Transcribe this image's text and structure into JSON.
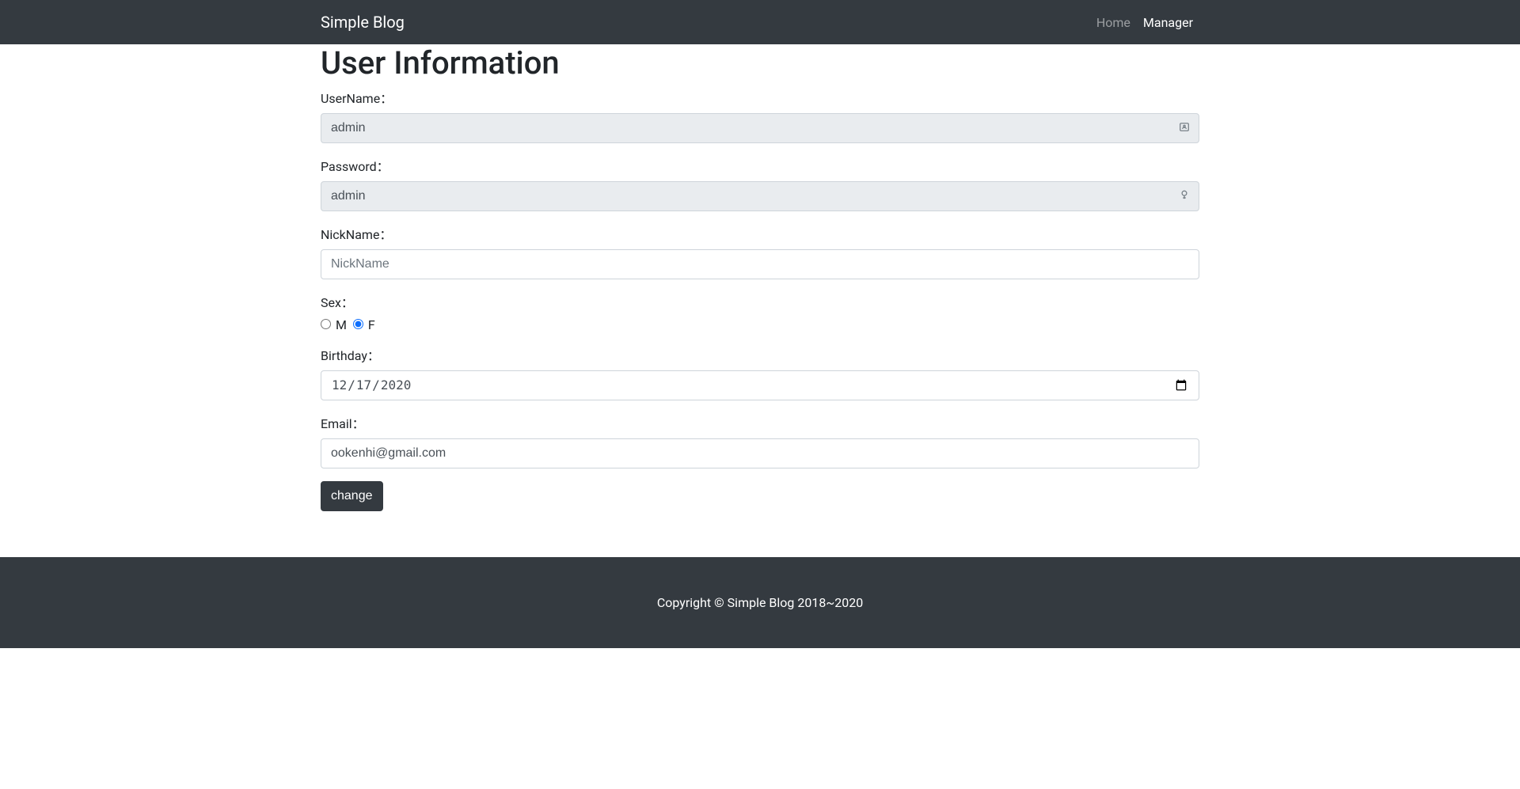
{
  "navbar": {
    "brand": "Simple Blog",
    "links": [
      {
        "label": "Home",
        "active": false
      },
      {
        "label": "Manager",
        "active": true
      }
    ]
  },
  "page": {
    "title": "User Information"
  },
  "form": {
    "username": {
      "label": "UserName：",
      "value": "admin"
    },
    "password": {
      "label": "Password：",
      "value": "admin"
    },
    "nickname": {
      "label": "NickName：",
      "placeholder": "NickName",
      "value": ""
    },
    "sex": {
      "label": "Sex：",
      "options": {
        "m": "M",
        "f": "F"
      },
      "selected": "f"
    },
    "birthday": {
      "label": "Birthday：",
      "value": "2020-12-17",
      "display": "12/17/2020"
    },
    "email": {
      "label": "Email：",
      "value": "ookenhi@gmail.com"
    },
    "submit": "change"
  },
  "footer": {
    "text": "Copyright © Simple Blog 2018~2020"
  }
}
